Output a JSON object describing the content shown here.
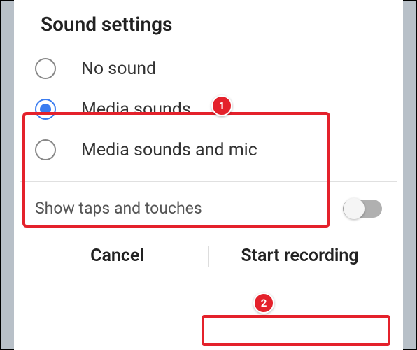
{
  "title": "Sound settings",
  "options": {
    "no_sound": "No sound",
    "media_sounds": "Media sounds",
    "media_mic": "Media sounds and mic"
  },
  "toggle_label": "Show taps and touches",
  "buttons": {
    "cancel": "Cancel",
    "start": "Start recording"
  },
  "markers": {
    "one": "1",
    "two": "2"
  }
}
